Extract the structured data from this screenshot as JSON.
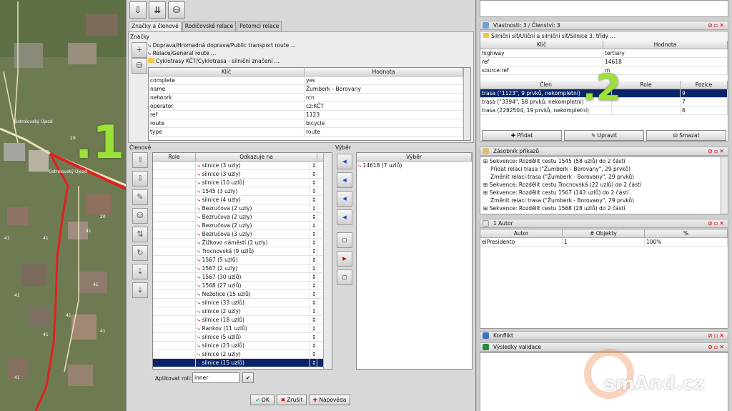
{
  "map": {
    "badge": "1",
    "annotation": ".1",
    "labels": [
      "Ostrolovský Újezd",
      "Ostrolovský Újezd"
    ],
    "house_numbers": [
      "29",
      "20",
      "41",
      "41",
      "41",
      "41",
      "41",
      "41",
      "41",
      "41",
      "41"
    ]
  },
  "toolbar": {
    "icons": [
      "download-relation-icon",
      "download-members-icon",
      "database-icon"
    ]
  },
  "tabs": [
    "Značky a členové",
    "Rodičovské relace",
    "Potomci relace"
  ],
  "tags_section": {
    "label": "Značky",
    "presets": [
      "Doprava/Hromadná doprava/Public transport route ...",
      "Relace/General route ...",
      "Cyklotrasy KČT/Cyklotrasa - silniční značení ..."
    ],
    "columns": [
      "Klíč",
      "Hodnota"
    ],
    "rows": [
      [
        "complete",
        "yes"
      ],
      [
        "name",
        "Žumberk - Borovany"
      ],
      [
        "network",
        "rcn"
      ],
      [
        "operator",
        "cz:KČT"
      ],
      [
        "ref",
        "1123"
      ],
      [
        "route",
        "bicycle"
      ],
      [
        "type",
        "route"
      ]
    ]
  },
  "members_section": {
    "label": "Členové",
    "columns": [
      "Role",
      "Odkazuje na"
    ],
    "rows": [
      "silnice (3 uzly)",
      "silnice (3 uzly)",
      "silnice (10 uzlů)",
      "1545 (3 uzly)",
      "silnice (4 uzly)",
      "Bezručova (2 uzly)",
      "Bezručova (2 uzly)",
      "Bezručova (2 uzly)",
      "Bezručova (3 uzly)",
      "Žižkovo náměstí (2 uzly)",
      "Trocnovská (9 uzlů)",
      "1567 (5 uzlů)",
      "1567 (2 uzly)",
      "1567 (30 uzlů)",
      "1568 (27 uzlů)",
      "Nežetice (15 uzlů)",
      "silnice (33 uzlů)",
      "silnice (2 uzly)",
      "silnice (18 uzlů)",
      "Rankov (11 uzlů)",
      "silnice (5 uzlů)",
      "silnice (23 uzlů)",
      "silnice (2 uzly)",
      "silnice (15 uzlů)"
    ],
    "selected_index": 23,
    "apply_role_label": "Aplikovat roli:",
    "role_value": "inner"
  },
  "selection_section": {
    "label": "Výběr",
    "column": "Výběr",
    "items": [
      "14618 (7 uzlů)"
    ]
  },
  "bottom_buttons": {
    "ok": "OK",
    "cancel": "Zrušit",
    "help": "Nápověda"
  },
  "properties": {
    "title": "Vlastnosti: 3 / Členství: 3",
    "preset": "Silniční síť/Uliční a silniční síť/Silnice 3. třídy ...",
    "columns": [
      "Klíč",
      "Hodnota"
    ],
    "rows": [
      [
        "highway",
        "tertiary"
      ],
      [
        "ref",
        "14618"
      ],
      [
        "source:ref",
        "m"
      ]
    ],
    "membership_columns": [
      "Člen",
      "Role",
      "Pozice"
    ],
    "memberships": [
      [
        "trasa (\"1123\", 9 prvků, nekompletní)",
        "",
        "9"
      ],
      [
        "trasa (\"3394\", 58 prvků, nekompletní)",
        "",
        "7"
      ],
      [
        "trasa (2282504, 19 prvků, nekompletní)",
        "",
        "6"
      ]
    ],
    "membership_selected": 0,
    "buttons": [
      "Přidat",
      "Upravit",
      "Smazat"
    ],
    "annotation": ".2"
  },
  "commands": {
    "title": "Zásobník příkazů",
    "items": [
      "Sekvence: Rozdělit cestu 1545 (58 uzlů) do 2 částí",
      "Přidat relaci trasa (\"Žumberk - Borovany\", 29 prvků)",
      "Změnit relaci trasa (\"Žumberk - Borovany\", 29 prvků)",
      "Sekvence: Rozdělit cestu Trocnovská (22 uzlů) do 2 částí",
      "Sekvence: Rozdělit cestu 1567 (143 uzlů) do 2 částí",
      "Změnit relaci trasa (\"Žumberk - Borovany\", 29 prvků)",
      "Sekvence: Rozdělit cestu 1568 (28 uzlů) do 2 částí"
    ]
  },
  "authors": {
    "title": "1 Autor",
    "columns": [
      "Autor",
      "# Objekty",
      "%"
    ],
    "rows": [
      [
        "elPresidento",
        "1",
        "100%"
      ]
    ]
  },
  "conflict": {
    "title": "Konflikt"
  },
  "validation": {
    "title": "Výsledky validace"
  },
  "watermark": "smAnd.cz",
  "colors": {
    "selection": "#0a246a",
    "route": "#e02020",
    "annotation": "#9be13a"
  }
}
